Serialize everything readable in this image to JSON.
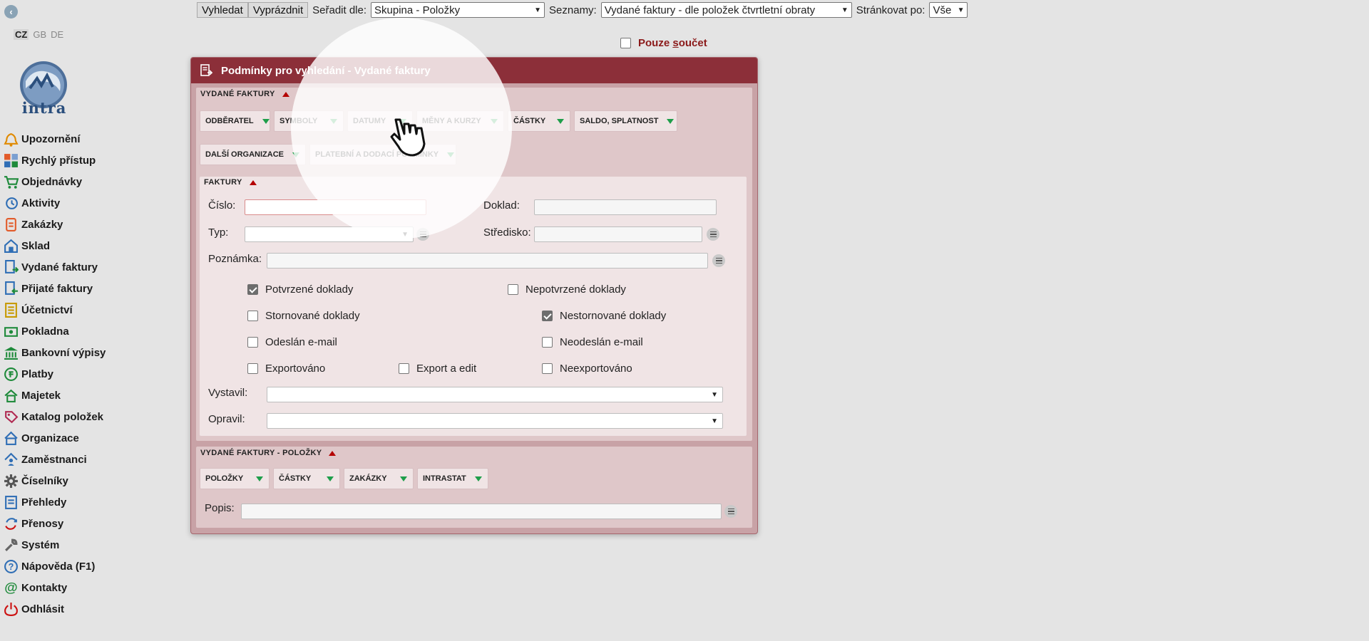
{
  "sidebar": {
    "languages": [
      "CZ",
      "GB",
      "DE"
    ],
    "logo_text": "intra",
    "items": [
      {
        "label": "Upozornění",
        "icon": "bell-icon",
        "color": "#e08a00"
      },
      {
        "label": "Rychlý přístup",
        "icon": "tiles-icon",
        "color": "#e25b2a"
      },
      {
        "label": "Objednávky",
        "icon": "cart-icon",
        "color": "#1e8a3a"
      },
      {
        "label": "Aktivity",
        "icon": "phone-clock-icon",
        "color": "#2f6eb5"
      },
      {
        "label": "Zakázky",
        "icon": "clipboard-icon",
        "color": "#e25b2a"
      },
      {
        "label": "Sklad",
        "icon": "warehouse-icon",
        "color": "#2f6eb5"
      },
      {
        "label": "Vydané faktury",
        "icon": "invoice-out-icon",
        "color": "#2f6eb5"
      },
      {
        "label": "Přijaté faktury",
        "icon": "invoice-in-icon",
        "color": "#2f6eb5"
      },
      {
        "label": "Účetnictví",
        "icon": "ledger-icon",
        "color": "#c79a00"
      },
      {
        "label": "Pokladna",
        "icon": "cash-icon",
        "color": "#1e8a3a"
      },
      {
        "label": "Bankovní výpisy",
        "icon": "bank-icon",
        "color": "#1e8a3a"
      },
      {
        "label": "Platby",
        "icon": "payment-icon",
        "color": "#1e8a3a"
      },
      {
        "label": "Majetek",
        "icon": "property-icon",
        "color": "#1e8a3a"
      },
      {
        "label": "Katalog položek",
        "icon": "tag-icon",
        "color": "#b02a52"
      },
      {
        "label": "Organizace",
        "icon": "building-icon",
        "color": "#2f6eb5"
      },
      {
        "label": "Zaměstnanci",
        "icon": "employees-icon",
        "color": "#2f6eb5"
      },
      {
        "label": "Číselníky",
        "icon": "gear-icon",
        "color": "#555555"
      },
      {
        "label": "Přehledy",
        "icon": "report-icon",
        "color": "#2f6eb5"
      },
      {
        "label": "Přenosy",
        "icon": "sync-icon",
        "color": "#2f6eb5"
      },
      {
        "label": "Systém",
        "icon": "wrench-icon",
        "color": "#666666"
      },
      {
        "label": "Nápověda (F1)",
        "icon": "help-icon",
        "color": "#2f6eb5"
      },
      {
        "label": "Kontakty",
        "icon": "at-icon",
        "color": "#1e8a3a"
      },
      {
        "label": "Odhlásit",
        "icon": "power-icon",
        "color": "#cc1111"
      }
    ]
  },
  "toolbar": {
    "search_label": "Vyhledat",
    "clear_label": "Vyprázdnit",
    "sort_label": "Seřadit dle:",
    "sort_value": "Skupina - Položky",
    "lists_label": "Seznamy:",
    "lists_value": "Vydané faktury - dle položek čtvrtletní obraty",
    "paging_label": "Stránkovat po:",
    "paging_value": "Vše",
    "only_sum_label": "Pouze součet",
    "only_sum_checked": false
  },
  "panel": {
    "title": "Podmínky pro vyhledání - Vydané faktury",
    "section1_title": "VYDANÉ FAKTURY",
    "section1_tabs": [
      "ODBĚRATEL",
      "SYMBOLY",
      "DATUMY",
      "MĚNY A KURZY",
      "ČÁSTKY",
      "SALDO, SPLATNOST"
    ],
    "section1_tabs2": [
      "DALŠÍ ORGANIZACE",
      "PLATEBNÍ A DODACÍ PODMÍNKY"
    ],
    "faktury": {
      "title": "FAKTURY",
      "cislo_label": "Číslo:",
      "doklad_label": "Doklad:",
      "typ_label": "Typ:",
      "stredisko_label": "Středisko:",
      "poznamka_label": "Poznámka:",
      "vystavil_label": "Vystavil:",
      "opravil_label": "Opravil:",
      "checks": [
        {
          "label": "Potvrzené doklady",
          "checked": true
        },
        {
          "label": "Nepotvrzené doklady",
          "checked": false
        },
        {
          "label": "Stornované doklady",
          "checked": false
        },
        {
          "label": "Nestornované doklady",
          "checked": true
        },
        {
          "label": "Odeslán e-mail",
          "checked": false
        },
        {
          "label": "Neodeslán e-mail",
          "checked": false
        },
        {
          "label": "Exportováno",
          "checked": false
        },
        {
          "label": "Export a edit",
          "checked": false
        },
        {
          "label": "Neexportováno",
          "checked": false
        }
      ]
    },
    "section2_title": "VYDANÉ FAKTURY - POLOŽKY",
    "section2_tabs": [
      "POLOŽKY",
      "ČÁSTKY",
      "ZAKÁZKY",
      "INTRASTAT"
    ],
    "popis_label": "Popis:"
  },
  "colors": {
    "panel_header": "#8c2f39",
    "panel_body": "#c8a2a6",
    "section_bg": "#dfc7c9",
    "accent_red": "#b40000",
    "accent_green": "#1e9e4a"
  }
}
